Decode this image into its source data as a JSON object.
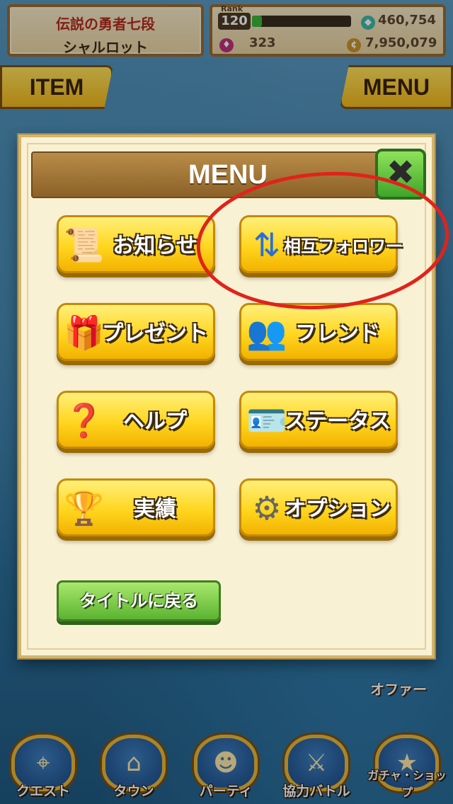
{
  "status": {
    "title_line1": "伝説の勇者七段",
    "title_line2": "シャルロット",
    "rank_label": "Rank",
    "rank": "120",
    "exp_progress": 0.1,
    "stamina": "460,754",
    "gems": "323",
    "coins": "7,950,079"
  },
  "top_buttons": {
    "item_label": "ITEM",
    "menu_label": "MENU"
  },
  "menu": {
    "title": "MENU",
    "close_icon": "close-x-icon",
    "items": [
      {
        "label": "お知らせ",
        "icon": "news-scroll-icon"
      },
      {
        "label": "相互フォロワー",
        "icon": "mutual-follow-icon"
      },
      {
        "label": "プレゼント",
        "icon": "gift-icon"
      },
      {
        "label": "フレンド",
        "icon": "friends-icon"
      },
      {
        "label": "ヘルプ",
        "icon": "help-icon"
      },
      {
        "label": "ステータス",
        "icon": "status-card-icon"
      },
      {
        "label": "実績",
        "icon": "trophy-icon"
      },
      {
        "label": "オプション",
        "icon": "gear-icon"
      }
    ],
    "back_label": "タイトルに戻る"
  },
  "side": {
    "offer_label": "オファー"
  },
  "nav": [
    {
      "label": "クエスト",
      "icon": "quest-map-icon"
    },
    {
      "label": "タウン",
      "icon": "town-icon"
    },
    {
      "label": "パーティ",
      "icon": "party-icon"
    },
    {
      "label": "協力バトル",
      "icon": "coop-battle-icon"
    },
    {
      "label": "ガチャ・ショップ",
      "icon": "gacha-shop-icon"
    }
  ],
  "colors": {
    "annotation": "#e0231b",
    "gold_button": "#ffd61f",
    "green_button": "#5bb431"
  }
}
